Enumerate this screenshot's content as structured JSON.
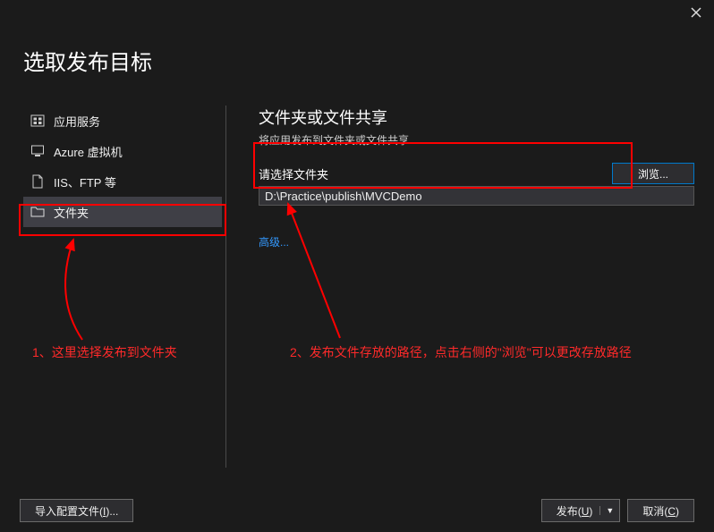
{
  "dialog": {
    "title": "选取发布目标"
  },
  "sidebar": {
    "items": [
      {
        "label": "应用服务"
      },
      {
        "label": "Azure 虚拟机"
      },
      {
        "label": "IIS、FTP 等"
      },
      {
        "label": "文件夹"
      }
    ]
  },
  "content": {
    "heading": "文件夹或文件共享",
    "subheading": "将应用发布到文件夹或文件共享",
    "folder_label": "请选择文件夹",
    "folder_value": "D:\\Practice\\publish\\MVCDemo",
    "browse_label": "浏览...",
    "advanced_link": "高级..."
  },
  "annotations": {
    "a1": "1、这里选择发布到文件夹",
    "a2": "2、发布文件存放的路径，点击右侧的\"浏览\"可以更改存放路径"
  },
  "buttons": {
    "import_profile": "导入配置文件(I)...",
    "publish": "发布(U)",
    "cancel": "取消(C)"
  }
}
